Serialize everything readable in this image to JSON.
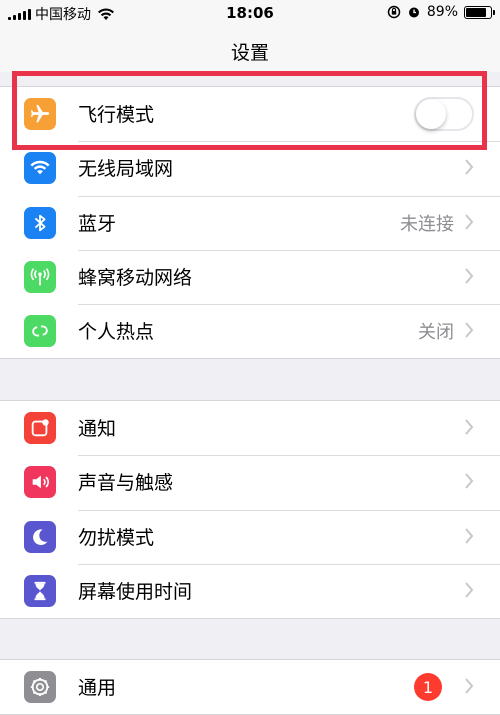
{
  "status_bar": {
    "carrier": "中国移动",
    "time": "18:06",
    "battery_percent": "89%",
    "battery_level": 0.89
  },
  "nav": {
    "title": "设置"
  },
  "groups": [
    {
      "items": [
        {
          "label": "飞行模式",
          "icon": "airplane-icon",
          "color": "#f7a035",
          "toggle_on": false
        },
        {
          "label": "无线局域网",
          "icon": "wifi-icon",
          "color": "#1b82f4"
        },
        {
          "label": "蓝牙",
          "icon": "bluetooth-icon",
          "color": "#1b82f4",
          "value": "未连接"
        },
        {
          "label": "蜂窝移动网络",
          "icon": "cellular-icon",
          "color": "#4cd964"
        },
        {
          "label": "个人热点",
          "icon": "hotspot-icon",
          "color": "#4cd964",
          "value": "关闭"
        }
      ]
    },
    {
      "items": [
        {
          "label": "通知",
          "icon": "notifications-icon",
          "color": "#f44239"
        },
        {
          "label": "声音与触感",
          "icon": "sound-icon",
          "color": "#f0365c"
        },
        {
          "label": "勿扰模式",
          "icon": "moon-icon",
          "color": "#5a56cf"
        },
        {
          "label": "屏幕使用时间",
          "icon": "hourglass-icon",
          "color": "#5a56cf"
        }
      ]
    },
    {
      "items": [
        {
          "label": "通用",
          "icon": "gear-icon",
          "color": "#8e8e93",
          "badge": "1"
        }
      ]
    }
  ]
}
